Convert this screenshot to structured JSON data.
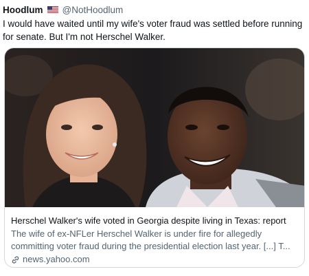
{
  "tweet": {
    "display_name": "Hoodlum",
    "flag_icon": "us-flag-icon",
    "handle": "@NotHoodlum",
    "text": "I would have waited until my wife's voter fraud was settled before running for senate. But I'm not Herschel Walker."
  },
  "card": {
    "image_alt": "photo-of-woman-and-man-smiling",
    "title": "Herschel Walker's wife voted in Georgia despite living in Texas: report",
    "description": "The wife of ex-NFLer Herschel Walker is under fire for allegedly committing voter fraud during the presidential election last year. [...] T...",
    "link_icon": "link-icon",
    "source": "news.yahoo.com"
  },
  "colors": {
    "text": "#0f1419",
    "secondary": "#536471",
    "border": "#cfd9de"
  }
}
